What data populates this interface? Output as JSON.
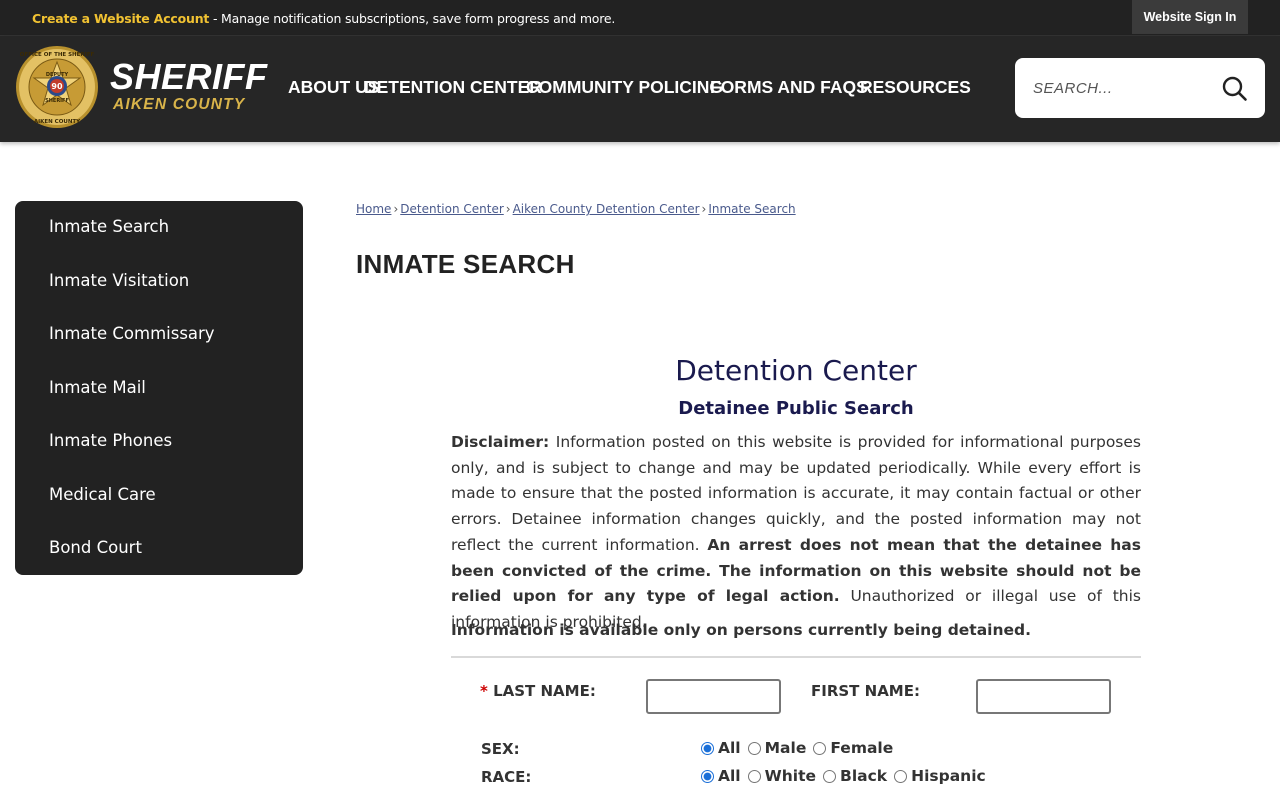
{
  "topbar": {
    "create_link": "Create a Website Account",
    "create_text": " - Manage notification subscriptions, save form progress and more.",
    "sign_in": "Website Sign In"
  },
  "header": {
    "title": "SHERIFF",
    "subtitle": "AIKEN COUNTY",
    "badge_text_top": "OFFICE OF THE SHERIFF",
    "badge_text_bottom": "AIKEN COUNTY",
    "badge_deputy": "DEPUTY",
    "badge_number": "90",
    "badge_sheriff": "SHERIFF",
    "nav": [
      "ABOUT US",
      "DETENTION CENTER",
      "COMMUNITY POLICING",
      "FORMS AND FAQS",
      "RESOURCES"
    ],
    "search_placeholder": "SEARCH..."
  },
  "sidebar": {
    "items": [
      "Inmate Search",
      "Inmate Visitation",
      "Inmate Commissary",
      "Inmate Mail",
      "Inmate Phones",
      "Medical Care",
      "Bond Court"
    ]
  },
  "breadcrumb": [
    "Home",
    "Detention Center",
    "Aiken County Detention Center",
    "Inmate Search"
  ],
  "page_title": "INMATE SEARCH",
  "content": {
    "heading": "Detention Center",
    "subheading": "Detainee Public Search",
    "disclaimer_label": "Disclaimer:",
    "disclaimer_text": " Information posted on this website is provided for informational purposes only, and is subject to change and may be updated periodically. While every effort is made to ensure that the posted information is accurate, it may contain factual or other errors. Detainee information changes quickly, and the posted information may not reflect the current information. ",
    "disclaimer_bold": "An arrest does not mean that the detainee has been convicted of the crime. The information on this website should not be relied upon for any type of legal action.",
    "disclaimer_tail": " Unauthorized or illegal use of this information is prohibited.",
    "availability": "Information is available only on persons currently being detained."
  },
  "form": {
    "required_mark": "*",
    "last_name_label": " LAST NAME:",
    "last_name_value": "",
    "first_name_label": "FIRST NAME:",
    "first_name_value": "",
    "sex_label": "SEX:",
    "sex_options": [
      "All",
      "Male",
      "Female"
    ],
    "sex_selected": "All",
    "race_label": "RACE:",
    "race_options": [
      "All",
      "White",
      "Black",
      "Hispanic"
    ],
    "race_selected": "All"
  },
  "colors": {
    "header_bg": "#262626",
    "accent_gold": "#d9b44a",
    "link_blue": "#4a5a8c",
    "heading_navy": "#1a1a4e"
  }
}
